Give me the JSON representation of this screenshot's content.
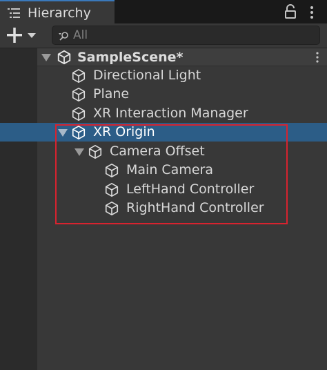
{
  "window": {
    "tab_title": "Hierarchy",
    "tab_icon": "list-icon",
    "lock_icon": "lock-icon",
    "menu_icon": "kebab-menu-icon"
  },
  "toolbar": {
    "add_icon": "plus-icon",
    "add_dropdown_icon": "triangle-down-icon",
    "search_icon": "search-icon",
    "search_placeholder": "All",
    "search_value": ""
  },
  "hierarchy": {
    "scene": {
      "name": "SampleScene*",
      "icon": "unity-logo-icon",
      "expanded": true
    },
    "items": [
      {
        "label": "Directional Light",
        "icon": "gameobject-cube-icon",
        "depth": 0
      },
      {
        "label": "Plane",
        "icon": "gameobject-cube-icon",
        "depth": 0
      },
      {
        "label": "XR Interaction Manager",
        "icon": "gameobject-cube-icon",
        "depth": 0
      },
      {
        "label": "XR Origin",
        "icon": "gameobject-cube-icon",
        "depth": 0,
        "selected": true,
        "expanded": true
      },
      {
        "label": "Camera Offset",
        "icon": "gameobject-cube-icon",
        "depth": 1,
        "expanded": true
      },
      {
        "label": "Main Camera",
        "icon": "gameobject-cube-icon",
        "depth": 2
      },
      {
        "label": "LeftHand Controller",
        "icon": "gameobject-cube-icon",
        "depth": 2
      },
      {
        "label": "RightHand Controller",
        "icon": "gameobject-cube-icon",
        "depth": 2
      }
    ]
  },
  "colors": {
    "selection": "#2c5d87",
    "highlight_box": "#d8232f",
    "tab_accent": "#3a79bb"
  }
}
